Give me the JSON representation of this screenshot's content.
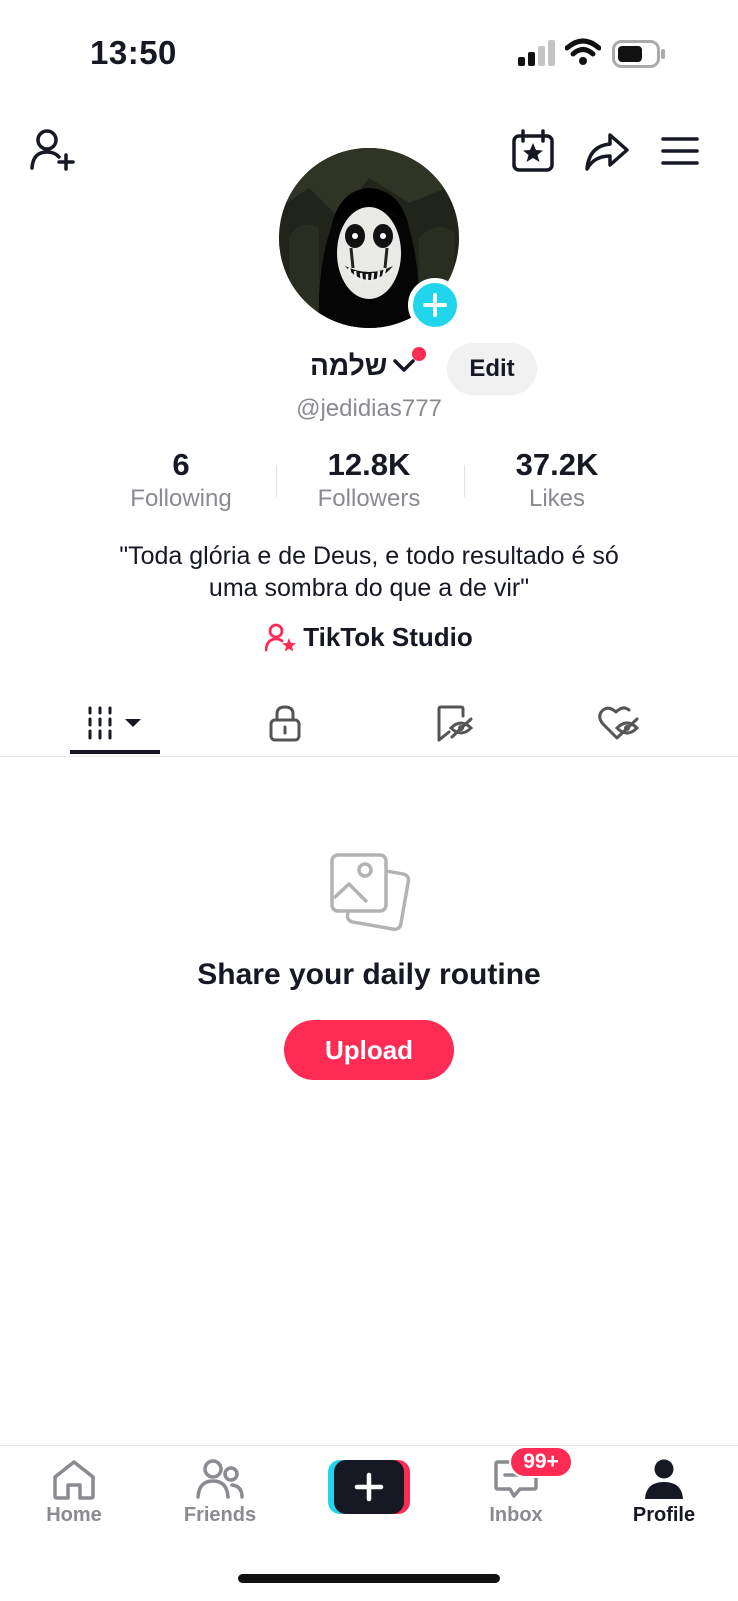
{
  "status_bar": {
    "time": "13:50"
  },
  "profile": {
    "display_name": "שלמה",
    "edit_label": "Edit",
    "username": "@jedidias777",
    "stats": [
      {
        "value": "6",
        "label": "Following"
      },
      {
        "value": "12.8K",
        "label": "Followers"
      },
      {
        "value": "37.2K",
        "label": "Likes"
      }
    ],
    "bio_line1": "\"Toda glória e de Deus, e todo resultado é só",
    "bio_line2": "uma sombra do que a de vir\"",
    "studio_label": "TikTok Studio"
  },
  "empty_state": {
    "title": "Share your daily routine",
    "upload_label": "Upload"
  },
  "bottom_nav": {
    "items": [
      {
        "label": "Home"
      },
      {
        "label": "Friends"
      },
      {
        "label": "Inbox"
      },
      {
        "label": "Profile"
      }
    ],
    "inbox_badge": "99+"
  },
  "colors": {
    "accent": "#fe2c55",
    "cyan": "#20d5ec",
    "text": "#161823",
    "muted": "#8a8b91"
  }
}
